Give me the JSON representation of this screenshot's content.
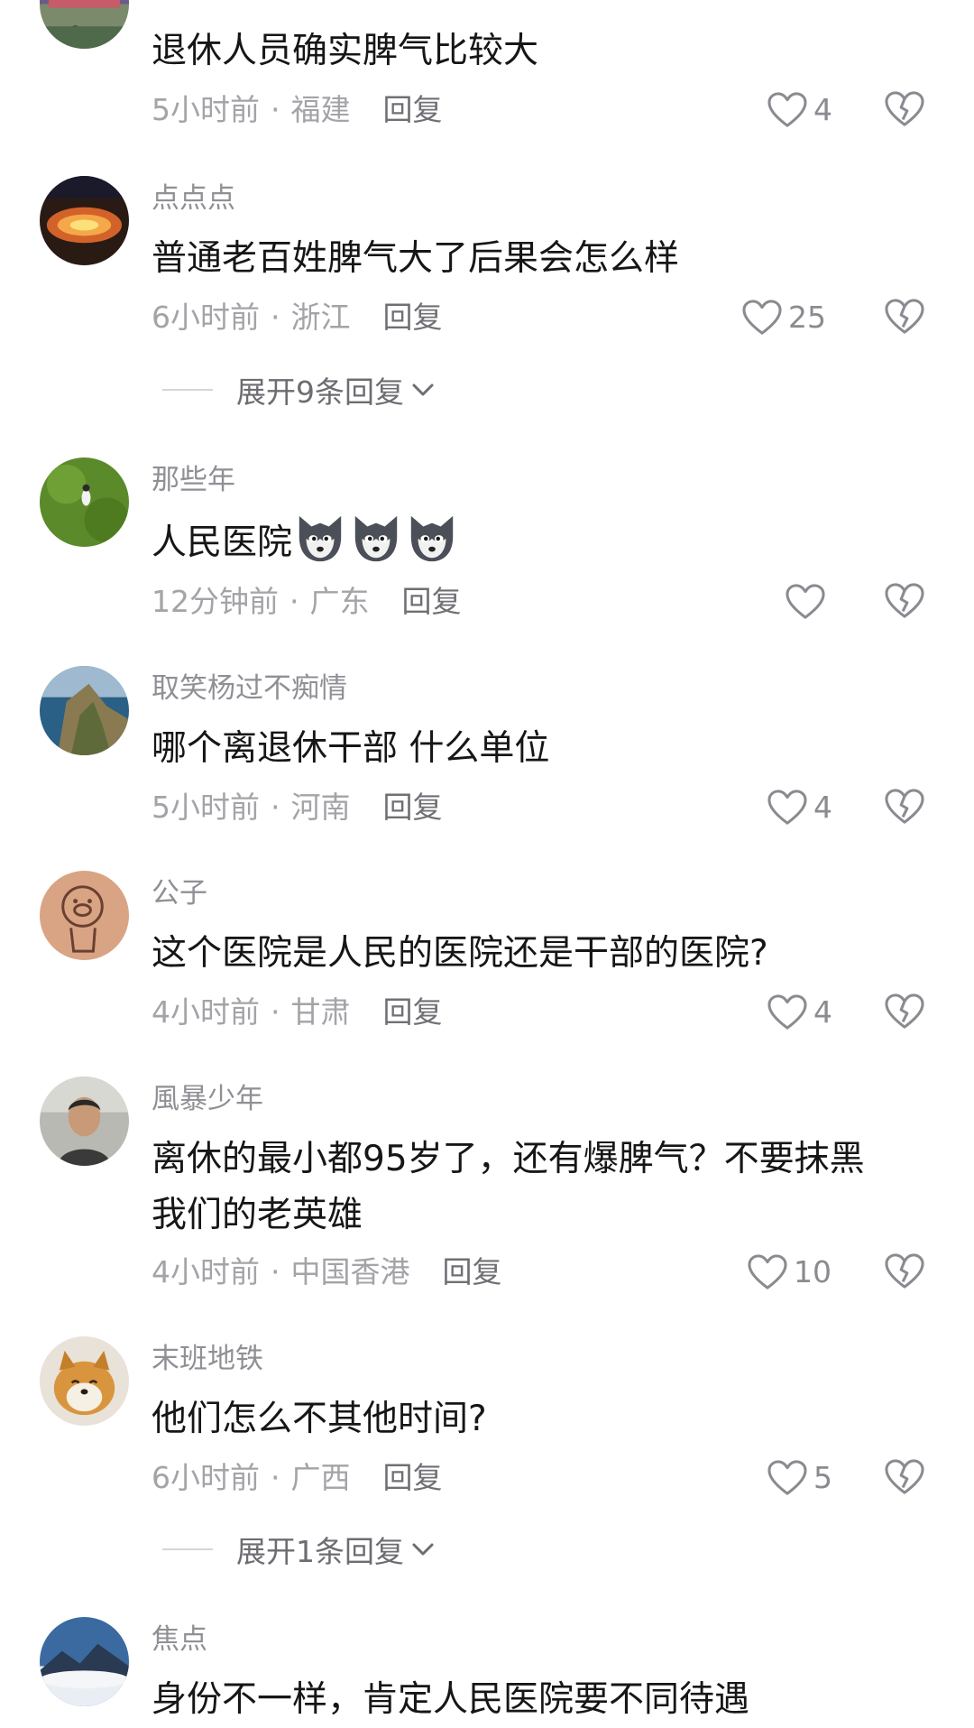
{
  "comments": [
    {
      "username": "",
      "text": [
        "退休人员确实脾气比较大"
      ],
      "time": "5小时前",
      "location": "福建",
      "reply_label": "回复",
      "likes": "4"
    },
    {
      "username": "点点点",
      "text": [
        "普通老百姓脾气大了后果会怎么样"
      ],
      "time": "6小时前",
      "location": "浙江",
      "reply_label": "回复",
      "likes": "25",
      "expand_label": "展开9条回复"
    },
    {
      "username": "那些年",
      "text": [
        "人民医院"
      ],
      "emoji_count": 3,
      "time": "12分钟前",
      "location": "广东",
      "reply_label": "回复",
      "likes": ""
    },
    {
      "username": "取笑杨过不痴情",
      "text": [
        "哪个离退休干部 什么单位"
      ],
      "time": "5小时前",
      "location": "河南",
      "reply_label": "回复",
      "likes": "4"
    },
    {
      "username": "公子",
      "text": [
        "这个医院是人民的医院还是干部的医院?"
      ],
      "time": "4小时前",
      "location": "甘肃",
      "reply_label": "回复",
      "likes": "4"
    },
    {
      "username": "風暴少年",
      "text": [
        "离休的最小都95岁了，还有爆脾气？不要抹黑",
        "我们的老英雄"
      ],
      "time": "4小时前",
      "location": "中国香港",
      "reply_label": "回复",
      "likes": "10"
    },
    {
      "username": "末班地铁",
      "text": [
        "他们怎么不其他时间?"
      ],
      "time": "6小时前",
      "location": "广西",
      "reply_label": "回复",
      "likes": "5",
      "expand_label": "展开1条回复"
    },
    {
      "username": "焦点",
      "text": [
        "身份不一样，肯定人民医院要不同待遇"
      ],
      "time": "",
      "location": "",
      "reply_label": "",
      "likes": ""
    }
  ],
  "icons": {
    "like": "heart-outline-icon",
    "dislike": "broken-heart-icon",
    "expand": "chevron-down-icon",
    "emoji": "husky-dog-emoji-icon"
  },
  "colors": {
    "username": "#8f8f95",
    "text": "#161616",
    "meta": "#a3a3a8",
    "reply": "#6f6f75"
  }
}
